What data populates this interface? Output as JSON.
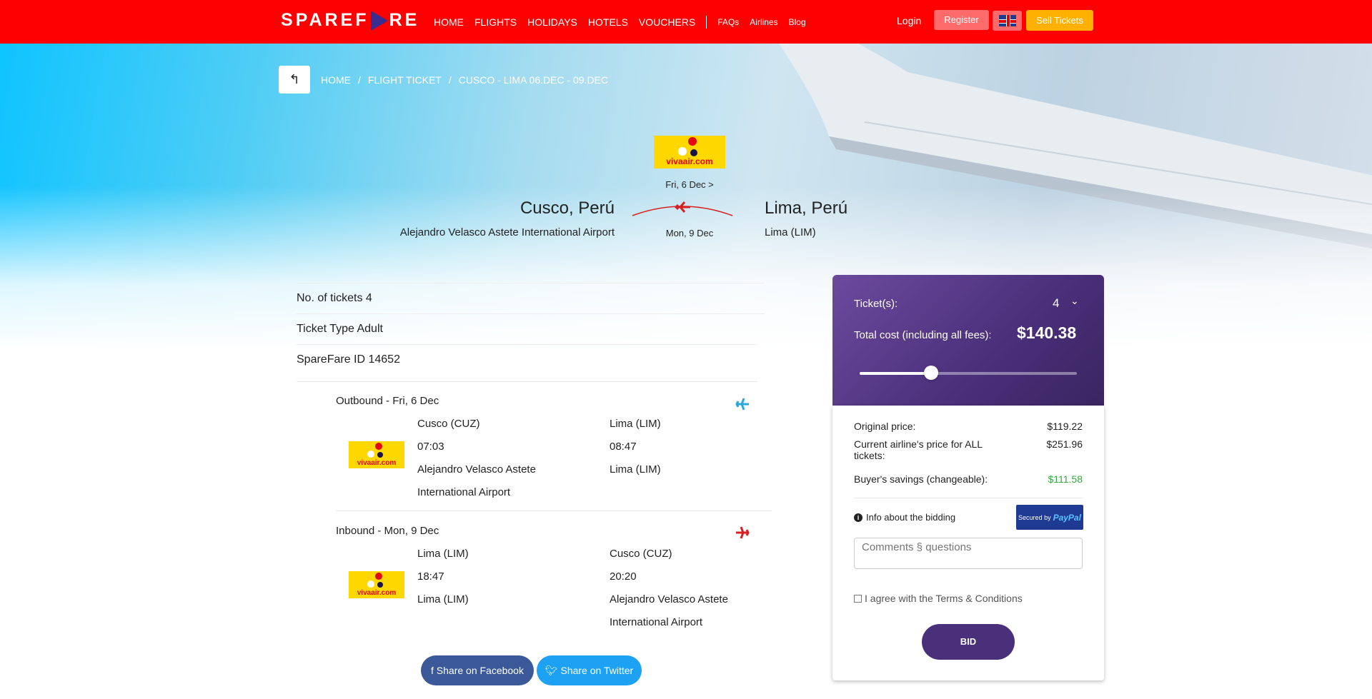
{
  "header": {
    "logo": "SPAREF RE",
    "nav": [
      {
        "label": "HOME"
      },
      {
        "label": "FLIGHTS"
      },
      {
        "label": "HOLIDAYS"
      },
      {
        "label": "HOTELS"
      },
      {
        "label": "VOUCHERS"
      }
    ],
    "nav_small": [
      {
        "label": "FAQs"
      },
      {
        "label": "Airlines"
      },
      {
        "label": "Blog"
      }
    ],
    "login": "Login",
    "register": "Register",
    "sell": "Sell Tickets",
    "flag_icon": "uk-flag-icon",
    "brand_color": "#ff0000"
  },
  "breadcrumb": {
    "back_icon": "back-arrow-icon",
    "items": [
      "HOME",
      "/",
      "FLIGHT TICKET",
      "/",
      "CUSCO - LIMA 06.DEC - 09.DEC"
    ]
  },
  "route": {
    "airline_logo": "vivaair.com",
    "date_out": "Fri, 6 Dec >",
    "date_in": "Mon, 9 Dec",
    "from_city": "Cusco, Perú",
    "from_airport": "Alejandro Velasco Astete International Airport",
    "to_city": "Lima, Perú",
    "to_airport": "Lima (LIM)"
  },
  "details": {
    "tickets": "No. of tickets 4",
    "type": "Ticket Type Adult",
    "id": "SpareFare ID 14652"
  },
  "outbound": {
    "title": "Outbound - Fri, 6 Dec",
    "airline": "vivaair.com",
    "from_code": "Cusco (CUZ)",
    "from_time": "07:03",
    "from_airport_1": "Alejandro Velasco Astete",
    "from_airport_2": "International Airport",
    "to_code": "Lima (LIM)",
    "to_time": "08:47",
    "to_airport": "Lima (LIM)"
  },
  "inbound": {
    "title": "Inbound - Mon, 9 Dec",
    "airline": "vivaair.com",
    "from_code": "Lima (LIM)",
    "from_time": "18:47",
    "from_airport": "Lima (LIM)",
    "to_code": "Cusco (CUZ)",
    "to_time": "20:20",
    "to_airport_1": "Alejandro Velasco Astete",
    "to_airport_2": "International Airport"
  },
  "share": {
    "facebook": "f Share on Facebook",
    "twitter": "Share on Twitter"
  },
  "bid": {
    "tickets_label": "Ticket(s):",
    "tickets_value": "4",
    "total_label": "Total cost (including all fees):",
    "total_value": "$140.38",
    "slider_level": 0.33,
    "original_label": "Original price:",
    "original_value": "$119.22",
    "airline_label_1": "Current airline's price for ALL",
    "airline_label_2": "tickets:",
    "airline_value": "$251.96",
    "savings_label": "Buyer's savings (changeable):",
    "savings_value": "$111.58",
    "info": "Info about the bidding",
    "paypal_secured": "Secured by",
    "paypal_brand": "PayPal",
    "comments_placeholder": "Comments § questions",
    "agree": "I agree with the Terms & Conditions",
    "bid_button": "BID"
  }
}
